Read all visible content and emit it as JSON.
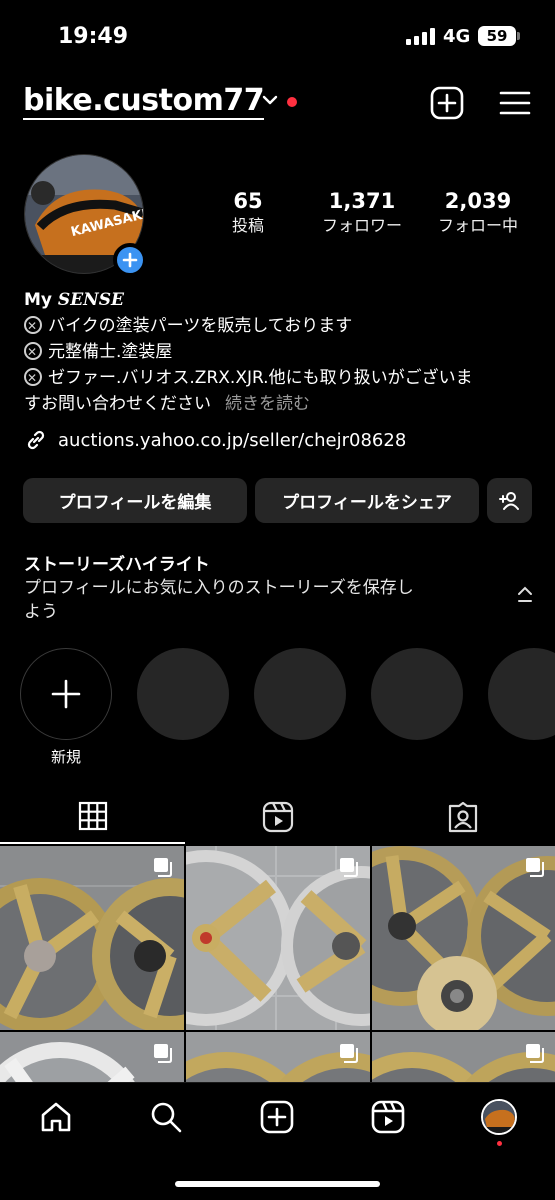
{
  "status_bar": {
    "time": "19:49",
    "network": "4G",
    "battery": "59"
  },
  "header": {
    "username": "bike.custom77"
  },
  "profile": {
    "stats": [
      {
        "value": "65",
        "label": "投稿"
      },
      {
        "value": "1,371",
        "label": "フォロワー"
      },
      {
        "value": "2,039",
        "label": "フォロー中"
      }
    ],
    "avatar_text": "KAWASAKI",
    "bio": {
      "name_prefix": "My ",
      "name_italic": "SENSE",
      "line1": "バイクの塗装パーツを販売しております",
      "line2": "元整備士.塗装屋",
      "line3a": "ゼファー.バリオス.ZRX.XJR.他にも取り扱いがございま",
      "line3b": "すお問い合わせください",
      "more": "続きを読む"
    },
    "link": "auctions.yahoo.co.jp/seller/chejr08628"
  },
  "buttons": {
    "edit": "プロフィールを編集",
    "share": "プロフィールをシェア"
  },
  "highlights": {
    "title": "ストーリーズハイライト",
    "subtitle": "プロフィールにお気に入りのストーリーズを保存しよう",
    "new_label": "新規"
  },
  "tabs": [
    "grid-icon",
    "reels-icon",
    "tagged-icon"
  ],
  "bottom_nav": [
    "home-icon",
    "search-icon",
    "create-icon",
    "reels-icon",
    "profile-avatar"
  ],
  "colors": {
    "accent_blue": "#3b93f2",
    "notification_red": "#ff3040",
    "button_bg": "#262626"
  }
}
